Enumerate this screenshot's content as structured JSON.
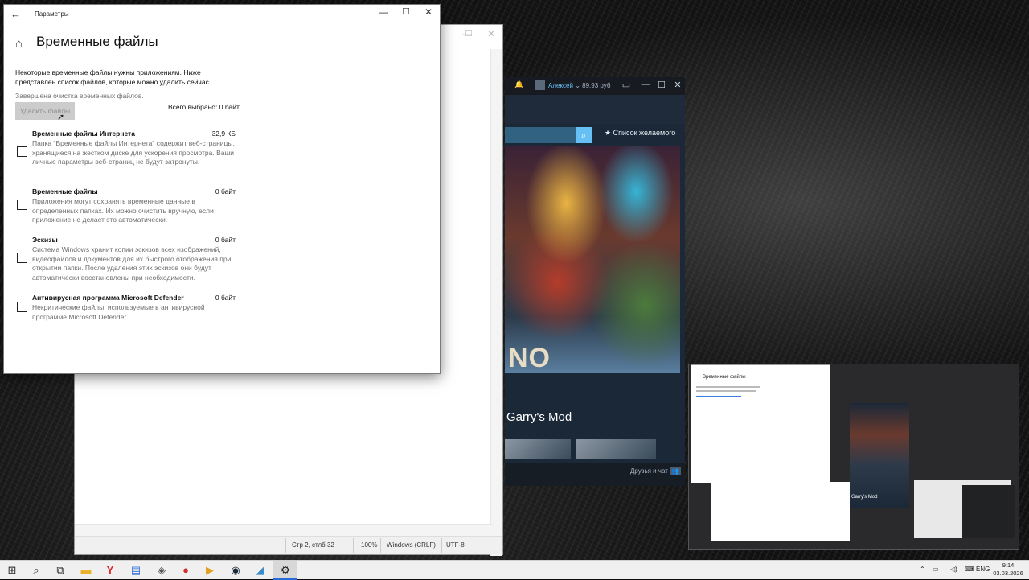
{
  "settings": {
    "app_title": "Параметры",
    "page_title": "Временные файлы",
    "description": "Некоторые временные файлы нужны приложениям. Ниже представлен список файлов, которые можно удалить сейчас.",
    "status": "Завершена очистка временных файлов.",
    "delete_button": "Удалить файлы",
    "total_selected": "Всего выбрано: 0 байт",
    "items": [
      {
        "name": "Временные файлы Интернета",
        "size": "32,9 КБ",
        "checked": false,
        "desc": "Папка \"Временные файлы Интернета\" содержит веб-страницы, хранящиеся на жестком диске для ускорения просмотра. Ваши личные параметры веб-страниц не будут затронуты."
      },
      {
        "name": "Временные файлы",
        "size": "0 байт",
        "checked": false,
        "desc": "Приложения могут сохранять временные данные в определенных папках. Их можно очистить вручную, если приложение не делает это автоматически."
      },
      {
        "name": "Эскизы",
        "size": "0 байт",
        "checked": false,
        "desc": "Система Windows хранит копии эскизов всех изображений, видеофайлов и документов для их быстрого отображения при открытии папки. После удаления этих эскизов они будут автоматически восстановлены при необходимости."
      },
      {
        "name": "Антивирусная программа Microsoft Defender",
        "size": "0 байт",
        "checked": false,
        "desc": "Некритические файлы, используемые в антивирусной программе Microsoft Defender"
      }
    ]
  },
  "notepad": {
    "status_position": "Стр 2, стлб 32",
    "status_zoom": "100%",
    "status_eol": "Windows (CRLF)",
    "status_encoding": "UTF-8"
  },
  "steam": {
    "username": "Алексей",
    "balance": "89,93 руб",
    "wishlist": "Список желаемого",
    "art_text": "NO",
    "game_title": "Garry's Mod",
    "friends_chat": "Друзья и чат"
  },
  "taskview": {
    "win1_title": "Временные файлы",
    "steam_game": "Garry's Mod"
  },
  "taskbar": {
    "icons": [
      "windows-start-icon",
      "search-icon",
      "task-view-icon",
      "file-explorer-icon",
      "yandex-browser-icon",
      "notepad-icon",
      "app-icon",
      "game-icon",
      "media-player-icon",
      "steam-icon",
      "app2-icon",
      "settings-icon"
    ],
    "language": "ENG",
    "time": "9:14",
    "date": "03.03.2026"
  }
}
